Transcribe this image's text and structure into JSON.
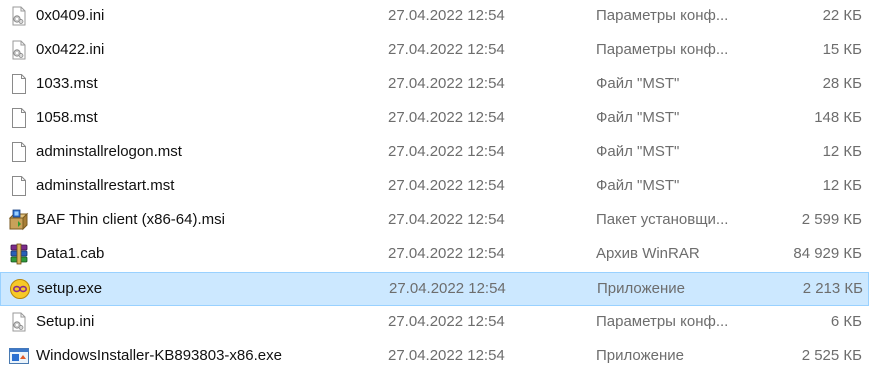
{
  "files": [
    {
      "name": "0x0409.ini",
      "date": "27.04.2022 12:54",
      "type": "Параметры конф...",
      "size": "22 КБ",
      "icon": "ini-file-icon",
      "selected": false
    },
    {
      "name": "0x0422.ini",
      "date": "27.04.2022 12:54",
      "type": "Параметры конф...",
      "size": "15 КБ",
      "icon": "ini-file-icon",
      "selected": false
    },
    {
      "name": "1033.mst",
      "date": "27.04.2022 12:54",
      "type": "Файл \"MST\"",
      "size": "28 КБ",
      "icon": "blank-file-icon",
      "selected": false
    },
    {
      "name": "1058.mst",
      "date": "27.04.2022 12:54",
      "type": "Файл \"MST\"",
      "size": "148 КБ",
      "icon": "blank-file-icon",
      "selected": false
    },
    {
      "name": "adminstallrelogon.mst",
      "date": "27.04.2022 12:54",
      "type": "Файл \"MST\"",
      "size": "12 КБ",
      "icon": "blank-file-icon",
      "selected": false
    },
    {
      "name": "adminstallrestart.mst",
      "date": "27.04.2022 12:54",
      "type": "Файл \"MST\"",
      "size": "12 КБ",
      "icon": "blank-file-icon",
      "selected": false
    },
    {
      "name": "BAF Thin client (x86-64).msi",
      "date": "27.04.2022 12:54",
      "type": "Пакет установщи...",
      "size": "2 599 КБ",
      "icon": "msi-package-icon",
      "selected": false
    },
    {
      "name": "Data1.cab",
      "date": "27.04.2022 12:54",
      "type": "Архив WinRAR",
      "size": "84 929 КБ",
      "icon": "winrar-archive-icon",
      "selected": false
    },
    {
      "name": "setup.exe",
      "date": "27.04.2022 12:54",
      "type": "Приложение",
      "size": "2 213 КБ",
      "icon": "setup-exe-icon",
      "selected": true
    },
    {
      "name": "Setup.ini",
      "date": "27.04.2022 12:54",
      "type": "Параметры конф...",
      "size": "6 КБ",
      "icon": "ini-file-icon",
      "selected": false
    },
    {
      "name": "WindowsInstaller-KB893803-x86.exe",
      "date": "27.04.2022 12:54",
      "type": "Приложение",
      "size": "2 525 КБ",
      "icon": "installer-exe-icon",
      "selected": false
    }
  ],
  "colors": {
    "selection_bg": "#cce8ff",
    "selection_border": "#99d1ff",
    "secondary_text": "#6d6d6d"
  }
}
